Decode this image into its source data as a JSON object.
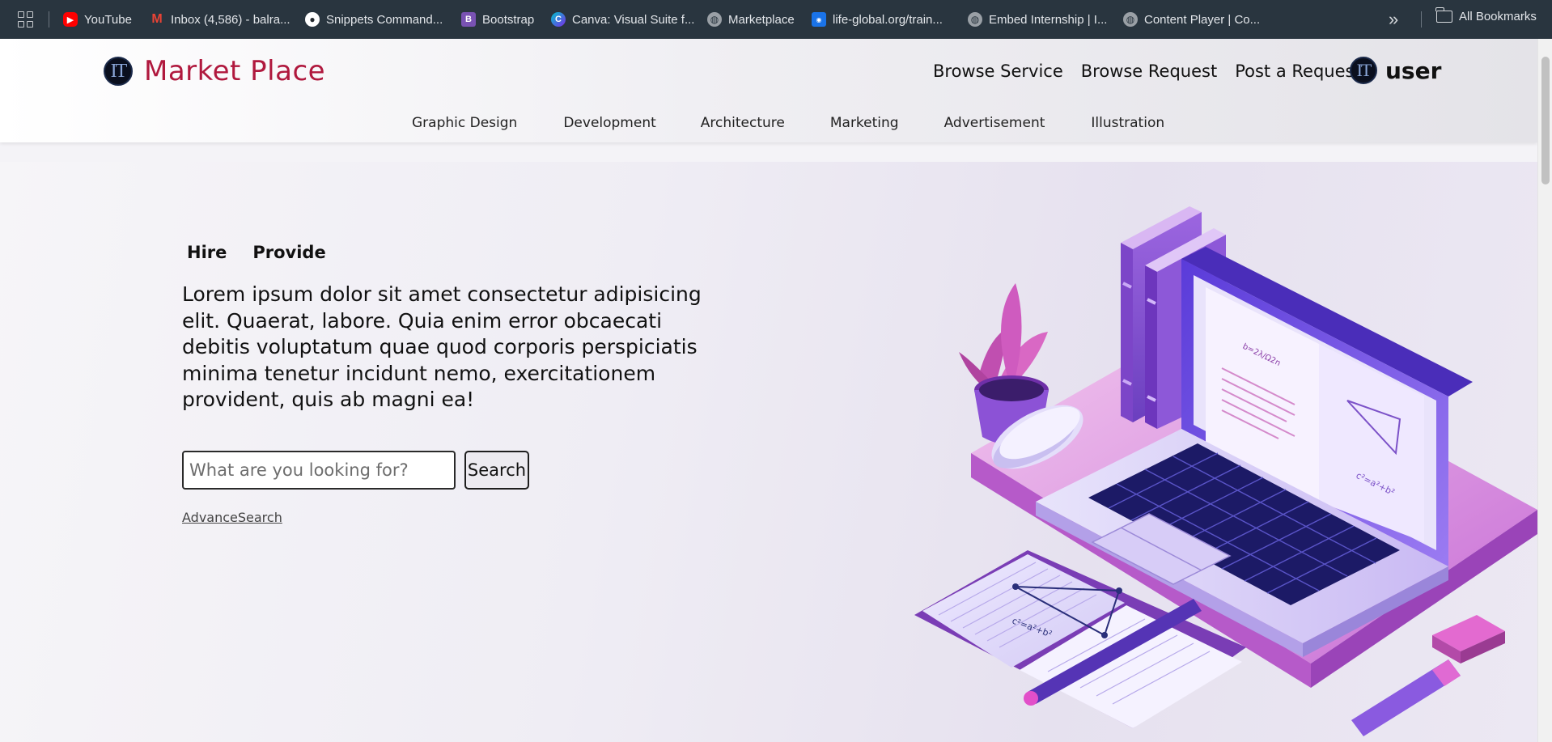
{
  "bookmarks": {
    "items": [
      {
        "label": "YouTube",
        "icon": "youtube-icon",
        "color": "#ff0000"
      },
      {
        "label": "Inbox (4,586) - balra...",
        "icon": "gmail-icon",
        "color": "#ea4335"
      },
      {
        "label": "Snippets Command...",
        "icon": "github-icon",
        "color": "#ffffff"
      },
      {
        "label": "Bootstrap",
        "icon": "bootstrap-icon",
        "color": "#7952b3"
      },
      {
        "label": "Canva: Visual Suite f...",
        "icon": "canva-icon",
        "color": "#00c4cc"
      },
      {
        "label": "Marketplace",
        "icon": "globe-icon",
        "color": "#9aa0a6"
      },
      {
        "label": "life-global.org/train...",
        "icon": "life-global-icon",
        "color": "#1a73e8"
      },
      {
        "label": "Embed Internship | I...",
        "icon": "globe-icon",
        "color": "#9aa0a6"
      },
      {
        "label": "Content Player | Co...",
        "icon": "globe-icon",
        "color": "#9aa0a6"
      }
    ],
    "more_label": "»",
    "all_bookmarks_label": "All Bookmarks"
  },
  "header": {
    "brand_logo": "IT",
    "brand_name": "Market Place",
    "brand_color": "#b0193e",
    "nav": [
      "Browse Service",
      "Browse Request",
      "Post a Request"
    ],
    "user_logo": "IT",
    "user_name": "user",
    "categories": [
      "Graphic Design",
      "Development",
      "Architecture",
      "Marketing",
      "Advertisement",
      "Illustration"
    ]
  },
  "hero": {
    "tabs": [
      "Hire",
      "Provide"
    ],
    "text": "Lorem ipsum dolor sit amet consectetur adipisicing elit. Quaerat, labore. Quia enim error obcaecati debitis voluptatum quae quod corporis perspiciatis minima tenetur incidunt nemo, exercitationem provident, quis ab magni ea!",
    "search_placeholder": "What are you looking for?",
    "search_button": "Search",
    "advance_search": "AdvanceSearch"
  },
  "illustration": {
    "book_title": "b=2λ/Ω2n",
    "formula": "c²=a²+b²"
  }
}
